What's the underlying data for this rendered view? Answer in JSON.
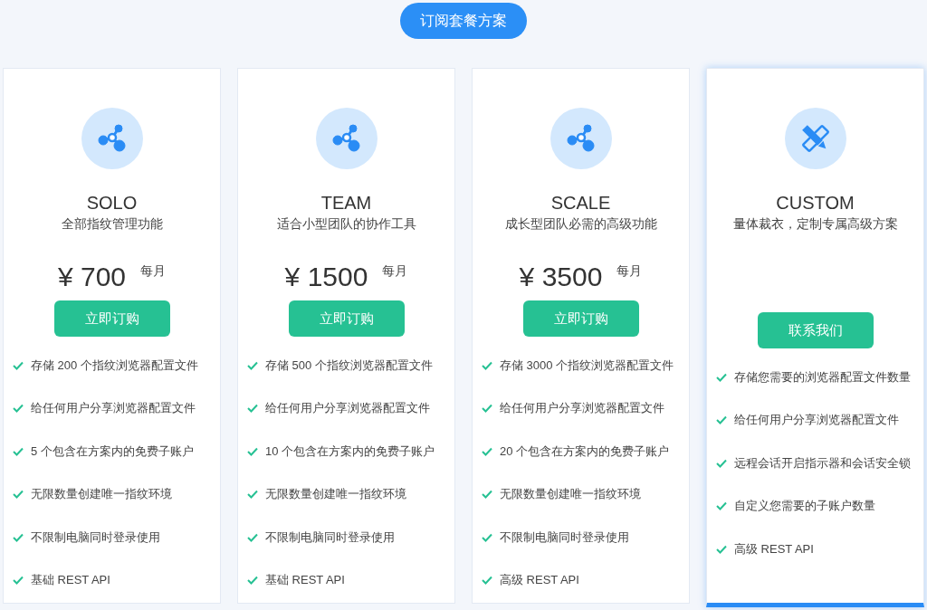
{
  "header_button": "订阅套餐方案",
  "plans": [
    {
      "kind": "standard",
      "highlighted": false,
      "name": "SOLO",
      "subtitle": "全部指纹管理功能",
      "price": "¥ 700",
      "period": "每月",
      "button": "立即订购",
      "features": [
        "存储 200 个指纹浏览器配置文件",
        "给任何用户分享浏览器配置文件",
        "5 个包含在方案内的免费子账户",
        "无限数量创建唯一指纹环境",
        "不限制电脑同时登录使用",
        "基础 REST API"
      ]
    },
    {
      "kind": "standard",
      "highlighted": false,
      "name": "TEAM",
      "subtitle": "适合小型团队的协作工具",
      "price": "¥ 1500",
      "period": "每月",
      "button": "立即订购",
      "features": [
        "存储 500 个指纹浏览器配置文件",
        "给任何用户分享浏览器配置文件",
        "10 个包含在方案内的免费子账户",
        "无限数量创建唯一指纹环境",
        "不限制电脑同时登录使用",
        "基础 REST API"
      ]
    },
    {
      "kind": "standard",
      "highlighted": false,
      "name": "SCALE",
      "subtitle": "成长型团队必需的高级功能",
      "price": "¥ 3500",
      "period": "每月",
      "button": "立即订购",
      "features": [
        "存储 3000 个指纹浏览器配置文件",
        "给任何用户分享浏览器配置文件",
        "20 个包含在方案内的免费子账户",
        "无限数量创建唯一指纹环境",
        "不限制电脑同时登录使用",
        "高级 REST API"
      ]
    },
    {
      "kind": "custom",
      "highlighted": true,
      "name": "CUSTOM",
      "subtitle": "量体裁衣，定制专属高级方案",
      "button": "联系我们",
      "features": [
        "存储您需要的浏览器配置文件数量",
        "给任何用户分享浏览器配置文件",
        "远程会话开启指示器和会话安全锁",
        "自定义您需要的子账户数量",
        "高级 REST API"
      ]
    }
  ]
}
